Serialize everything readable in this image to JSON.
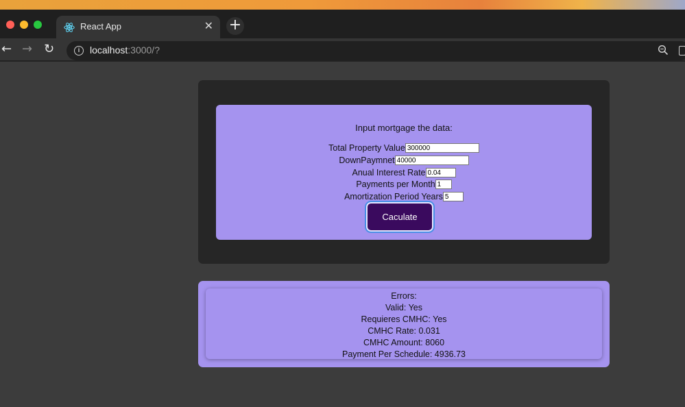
{
  "browser": {
    "tab_title": "React App",
    "tab_close": "✕",
    "new_tab": "+",
    "url_host": "localhost",
    "url_rest": ":3000/?"
  },
  "form": {
    "heading": "Input mortgage the data:",
    "fields": [
      {
        "label": "Total Property Value",
        "value": "300000"
      },
      {
        "label": "DownPaymnet",
        "value": "40000"
      },
      {
        "label": "Anual Interest Rate",
        "value": "0.04"
      },
      {
        "label": "Payments per Month",
        "value": "1"
      },
      {
        "label": "Amortization Period Years",
        "value": "5"
      }
    ],
    "button_label": "Caculate"
  },
  "results": {
    "errors": "Errors:",
    "valid": "Valid: Yes",
    "requires_cmhc": "Requieres CMHC: Yes",
    "cmhc_rate": "CMHC Rate: 0.031",
    "cmhc_amount": "CMHC Amount: 8060",
    "payment": "Payment Per Schedule: 4936.73"
  },
  "colors": {
    "form_bg": "#a593ef",
    "button_bg": "#3a0a5e",
    "card_bg": "#262626",
    "page_bg": "#3c3c3c"
  },
  "icons": [
    "react-logo-icon",
    "close-icon",
    "plus-icon",
    "back-arrow-icon",
    "forward-arrow-icon",
    "reload-icon",
    "info-icon",
    "zoom-icon",
    "extension-icon"
  ]
}
